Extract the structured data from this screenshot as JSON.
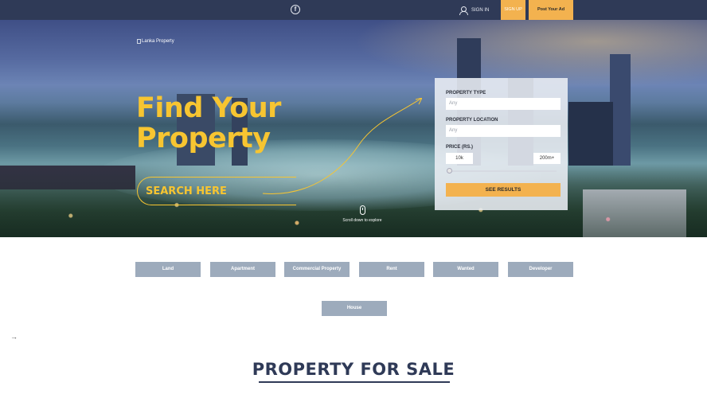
{
  "header": {
    "social": "f",
    "sign_in": "SIGN IN",
    "sign_up": "SIGN UP",
    "post_ad": "Post Your Ad"
  },
  "hero": {
    "logo_alt": "Lanka Property",
    "headline_line1": "Find Your",
    "headline_line2": "Property",
    "search_here": "SEARCH HERE",
    "scroll_hint": "Scroll down to explore"
  },
  "search_panel": {
    "property_type_label": "PROPERTY TYPE",
    "property_type_placeholder": "Any",
    "property_location_label": "PROPERTY LOCATION",
    "property_location_placeholder": "Any",
    "price_label": "PRICE (RS.)",
    "price_min": "10k",
    "price_max": "200m+",
    "submit_label": "SEE RESULTS"
  },
  "categories": [
    "Land",
    "Apartment",
    "Commercial Property",
    "Rent",
    "Wanted",
    "Developer",
    "House"
  ],
  "misc": {
    "arrow": "→"
  },
  "section": {
    "title": "PROPERTY FOR SALE"
  },
  "colors": {
    "navy": "#2f3a57",
    "accent": "#f3b24f",
    "headline": "#f7c531",
    "category": "#9dabbc"
  }
}
